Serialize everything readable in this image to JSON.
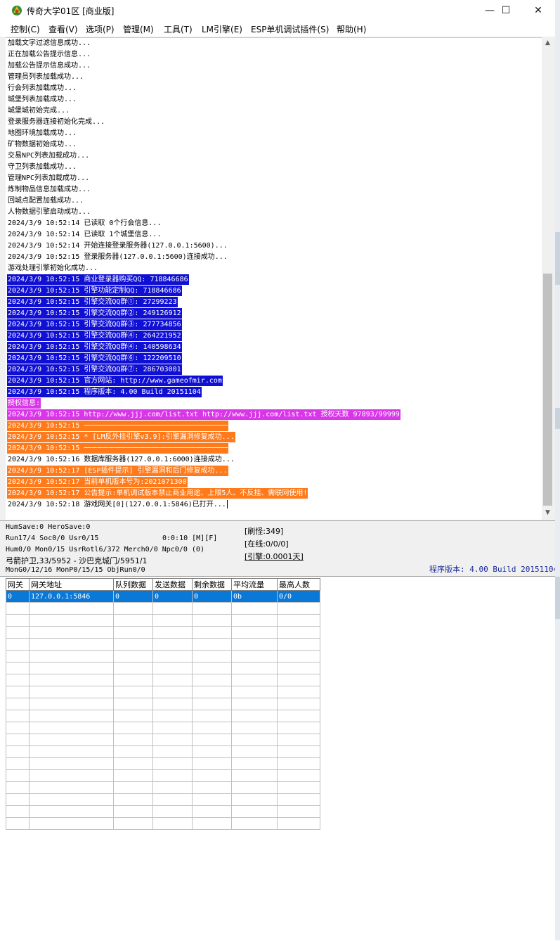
{
  "window": {
    "title": "传奇大学01区 [商业版]",
    "controls": {
      "minimize": "—",
      "maximize": "☐",
      "close": "✕"
    }
  },
  "menu": [
    {
      "label": "控制(C)"
    },
    {
      "label": "查看(V)"
    },
    {
      "label": "选项(P)"
    },
    {
      "label": "管理(M)"
    },
    {
      "label": "工具(T)"
    },
    {
      "label": "LM引擎(E)"
    },
    {
      "label": "ESP单机调试插件(S)"
    },
    {
      "label": "帮助(H)"
    }
  ],
  "log": {
    "lines": [
      {
        "text": "加载文字过滤信息成功...",
        "style": "plain"
      },
      {
        "text": "正在加载公告提示信息...",
        "style": "plain"
      },
      {
        "text": "加载公告提示信息成功...",
        "style": "plain"
      },
      {
        "text": "管理员列表加载成功...",
        "style": "plain"
      },
      {
        "text": "行会列表加载成功...",
        "style": "plain"
      },
      {
        "text": "城堡列表加载成功...",
        "style": "plain"
      },
      {
        "text": "城堡城初始完成...",
        "style": "plain"
      },
      {
        "text": "登录服务器连接初始化完成...",
        "style": "plain"
      },
      {
        "text": "地图环境加载成功...",
        "style": "plain"
      },
      {
        "text": "矿物数据初始成功...",
        "style": "plain"
      },
      {
        "text": "交易NPC列表加载成功...",
        "style": "plain"
      },
      {
        "text": "守卫列表加载成功...",
        "style": "plain"
      },
      {
        "text": "管理NPC列表加载成功...",
        "style": "plain"
      },
      {
        "text": "炼制物品信息加载成功...",
        "style": "plain"
      },
      {
        "text": "回城点配置加载成功...",
        "style": "plain"
      },
      {
        "text": "人物数据引擎启动成功...",
        "style": "plain"
      },
      {
        "text": "2024/3/9 10:52:14 已读取 0个行会信息...",
        "style": "plain"
      },
      {
        "text": "2024/3/9 10:52:14 已读取 1个城堡信息...",
        "style": "plain"
      },
      {
        "text": "2024/3/9 10:52:14 开始连接登录服务器(127.0.0.1:5600)...",
        "style": "plain"
      },
      {
        "text": "2024/3/9 10:52:15 登录服务器(127.0.0.1:5600)连接成功...",
        "style": "plain"
      },
      {
        "text": "游戏处理引擎初始化成功...",
        "style": "plain"
      },
      {
        "text": "2024/3/9 10:52:15 商业登录器购买QQ: 718846686",
        "style": "blue"
      },
      {
        "text": "2024/3/9 10:52:15 引擎功能定制QQ: 718846686",
        "style": "blue"
      },
      {
        "text": "2024/3/9 10:52:15 引擎交流QQ群①: 27299223",
        "style": "blue"
      },
      {
        "text": "2024/3/9 10:52:15 引擎交流QQ群②: 249126912",
        "style": "blue"
      },
      {
        "text": "2024/3/9 10:52:15 引擎交流QQ群③: 277734856",
        "style": "blue"
      },
      {
        "text": "2024/3/9 10:52:15 引擎交流QQ群④: 264221952",
        "style": "blue"
      },
      {
        "text": "2024/3/9 10:52:15 引擎交流QQ群④: 140598634",
        "style": "blue"
      },
      {
        "text": "2024/3/9 10:52:15 引擎交流QQ群⑥: 122209510",
        "style": "blue"
      },
      {
        "text": "2024/3/9 10:52:15 引擎交流QQ群⑦: 286703001",
        "style": "blue"
      },
      {
        "text": "2024/3/9 10:52:15 官方网站: http://www.gameofmir.com",
        "style": "blue"
      },
      {
        "text": "2024/3/9 10:52:15 程序版本: 4.00 Build 20151104",
        "style": "blue"
      },
      {
        "text": "授权信息:",
        "style": "magenta"
      },
      {
        "text": "2024/3/9 10:52:15 http://www.jjj.com/list.txt http://www.jjj.com/list.txt 授权天数 97893/99999",
        "style": "magenta"
      },
      {
        "text": "2024/3/9 10:52:15 ──────────────────────────────────",
        "style": "orange"
      },
      {
        "text": "2024/3/9 10:52:15 * [LM反外挂引擎v3.9]:引擎漏洞修复成功...       ",
        "style": "orange"
      },
      {
        "text": "2024/3/9 10:52:15 ──────────────────────────────────",
        "style": "orange"
      },
      {
        "text": "2024/3/9 10:52:16 数据库服务器(127.0.0.1:6000)连接成功...",
        "style": "plain"
      },
      {
        "text": "2024/3/9 10:52:17 [ESP插件提示] 引擎漏洞和后门修复成功...",
        "style": "orange"
      },
      {
        "text": "2024/3/9 10:52:17 当前单机版本号为:2021071300",
        "style": "orange"
      },
      {
        "text": "2024/3/9 10:52:17 公告提示:单机调试版本禁止商业用途、上限5人、不反挂、需联网使用!",
        "style": "orange"
      },
      {
        "text": "2024/3/9 10:52:18 游戏网关[0](127.0.0.1:5846)已打开...",
        "style": "plain",
        "caret": true
      }
    ]
  },
  "status": {
    "l1": "HumSave:0 HeroSave:0",
    "l2a": "Run17/4 Soc0/0 Usr0/15",
    "l2b": "0:0:10 [M][F]",
    "l3": "Hum0/0 Mon0/15 UsrRotl6/372 Merch0/0 Npc0/0 (0)",
    "l4": "弓箭护卫,33/5952 - 沙巴克城门/5951/1",
    "l5": "MonG0/12/16 MonP0/15/15 ObjRun0/0",
    "refresh": "[刷怪:349]",
    "online": "[在线:0/0/0]",
    "engine": "[引擎:0.0001天]",
    "version": "程序版本: 4.00 Build 20151104"
  },
  "gateway_table": {
    "headers": [
      "网关",
      "网关地址",
      "队列数据",
      "发送数据",
      "剩余数据",
      "平均流量",
      "最高人数"
    ],
    "rows": [
      [
        "0",
        "127.0.0.1:5846",
        "0",
        "0",
        "0",
        "0b",
        "0/0"
      ]
    ],
    "empty_rows": 19
  }
}
